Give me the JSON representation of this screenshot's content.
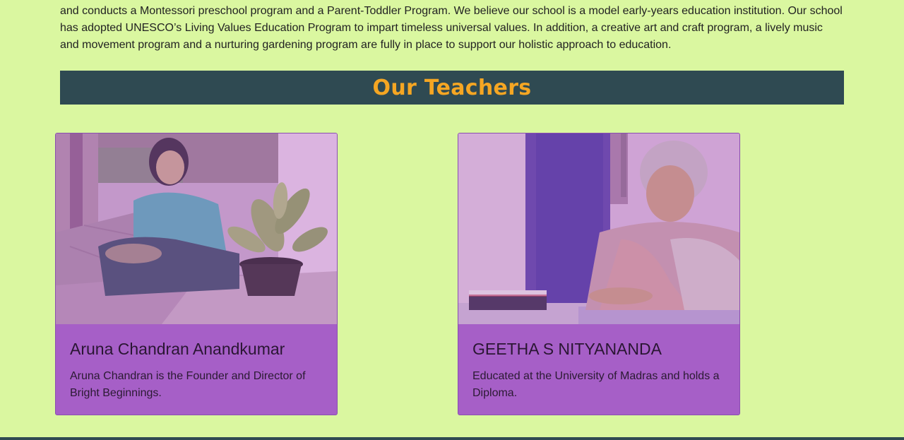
{
  "intro": {
    "text": "and conducts a Montessori preschool program and a Parent-Toddler Program. We believe our school is a model early-years education institution. Our school has adopted UNESCO’s Living Values Education Program to impart timeless universal values. In addition, a creative art and craft program, a lively music and movement program and a nurturing gardening program are fully in place to support our holistic approach to education."
  },
  "teachers_section": {
    "title": "Our Teachers"
  },
  "teachers": [
    {
      "name": "Aruna Chandran Anandkumar",
      "description": "Aruna Chandran is the Founder and Director of Bright Beginnings."
    },
    {
      "name": "GEETHA S NITYANANDA",
      "description": "Educated at the University of Madras and holds a Diploma."
    }
  ],
  "colors": {
    "background": "#daf7a0",
    "banner": "#2f4a52",
    "title": "#f5a623",
    "card": "#a65fc7"
  }
}
